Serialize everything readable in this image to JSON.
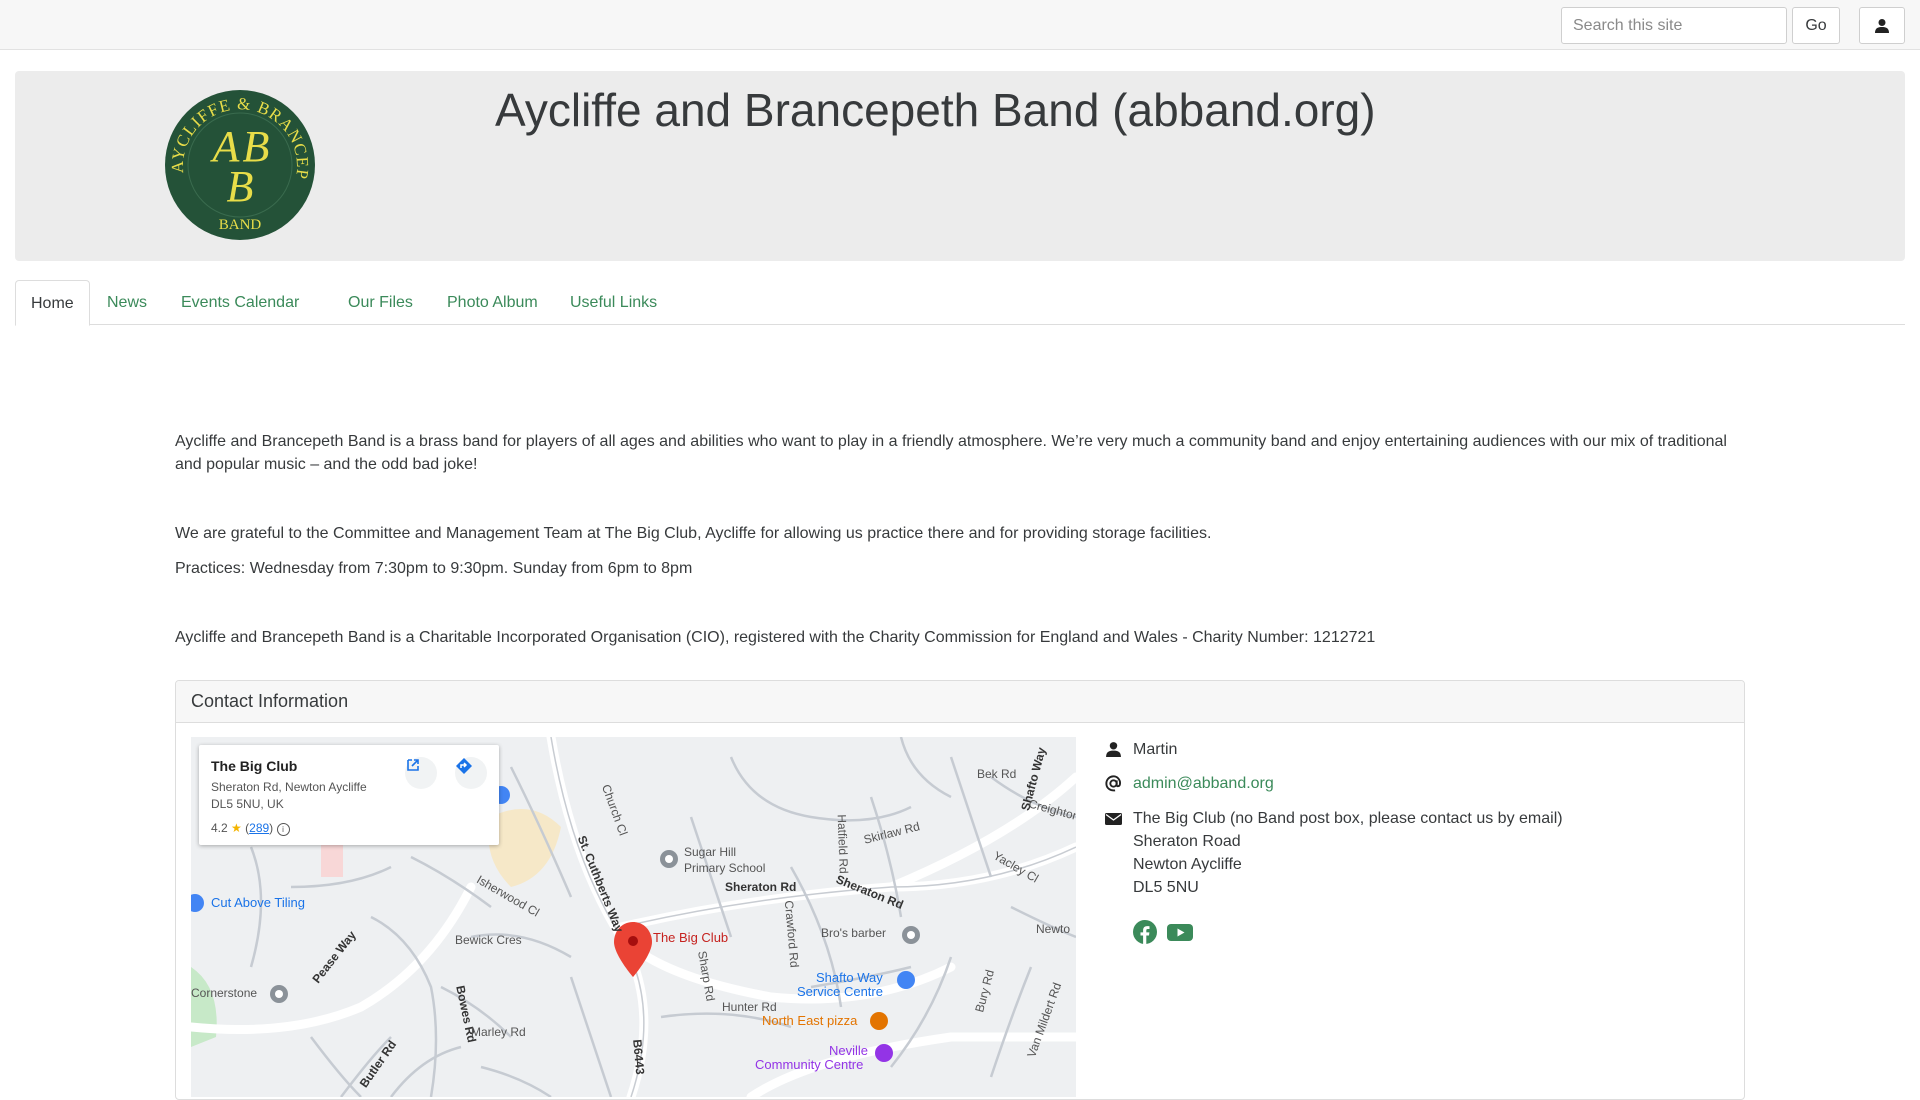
{
  "topbar": {
    "search_placeholder": "Search this site",
    "go_label": "Go",
    "user_icon": "user-icon"
  },
  "banner": {
    "title": "Aycliffe and Brancepeth Band (abband.org)",
    "logo": {
      "ring_text": "AYCLIFFE & BRANCEPETH BAND",
      "monogram": "ABB",
      "bg_color": "#245238",
      "text_color": "#e8dd49"
    }
  },
  "nav": {
    "tabs": [
      {
        "label": "Home",
        "active": true
      },
      {
        "label": "News",
        "active": false
      },
      {
        "label": "Events Calendar",
        "active": false
      },
      {
        "label": "Our Files",
        "active": false
      },
      {
        "label": "Photo Album",
        "active": false
      },
      {
        "label": "Useful Links",
        "active": false
      }
    ]
  },
  "main": {
    "intro": "Aycliffe and Brancepeth Band is a brass band for players of all ages and abilities who want to play in a friendly atmosphere. We’re very much a community band and enjoy entertaining audiences with our mix of traditional and popular music – and the odd bad joke!",
    "thanks": "We are grateful to the Committee and Management Team at The Big Club, Aycliffe for allowing us practice there and for providing storage facilities.",
    "practices": "Practices:  Wednesday from 7:30pm to 9:30pm.  Sunday from 6pm to 8pm",
    "charity": "Aycliffe and Brancepeth Band is a Charitable Incorporated Organisation (CIO), registered with the Charity Commission for England and Wales - Charity Number: 1212721"
  },
  "contact": {
    "header": "Contact Information",
    "name": "Martin",
    "email": "admin@abband.org",
    "address": [
      "The Big Club (no Band post box, please contact us by email)",
      "Sheraton Road",
      "Newton Aycliffe",
      "DL5 5NU"
    ],
    "social": [
      "facebook-icon",
      "youtube-icon"
    ],
    "accent_color": "#3b8a5a"
  },
  "map": {
    "place_name": "The Big Club",
    "place_addr1": "Sheraton Rd, Newton Aycliffe",
    "place_addr2": "DL5 5NU, UK",
    "rating": "4.2",
    "review_count": "289",
    "labels": {
      "pin": "The Big Club",
      "sugar_hill_1": "Sugar Hill",
      "sugar_hill_2": "Primary School",
      "sheraton_1": "Sheraton Rd",
      "sheraton_2": "Sheraton Rd",
      "cut_above": "Cut Above Tiling",
      "cornerstone": "Cornerstone",
      "st_cuthberts": "St. Cuthberts Way",
      "bros_barber": "Bro's barber",
      "shafto_service_1": "Shafto Way",
      "shafto_service_2": "Service Centre",
      "north_east_pizza": "North East pizza",
      "neville_1": "Neville",
      "neville_2": "Community Centre",
      "skirlaw": "Skirlaw Rd",
      "bek": "Bek Rd",
      "shafto_way": "Shafto Way",
      "creighton": "Creighton",
      "yacley": "Yacley Cl",
      "hatfield": "Hatfield Rd",
      "church": "Church Cl",
      "isherwood": "Isherwood Cl",
      "bewick_cres": "Bewick Cres",
      "bowes": "Bowes Rd",
      "marley": "Marley Rd",
      "hunter": "Hunter Rd",
      "crawford": "Crawford Rd",
      "sharp": "Sharp Rd",
      "bury": "Bury Rd",
      "van_mildert": "Van Mildert Rd",
      "pease_way": "Pease Way",
      "butler": "Butler Rd",
      "b6443": "B6443",
      "newton": "Newto"
    }
  }
}
